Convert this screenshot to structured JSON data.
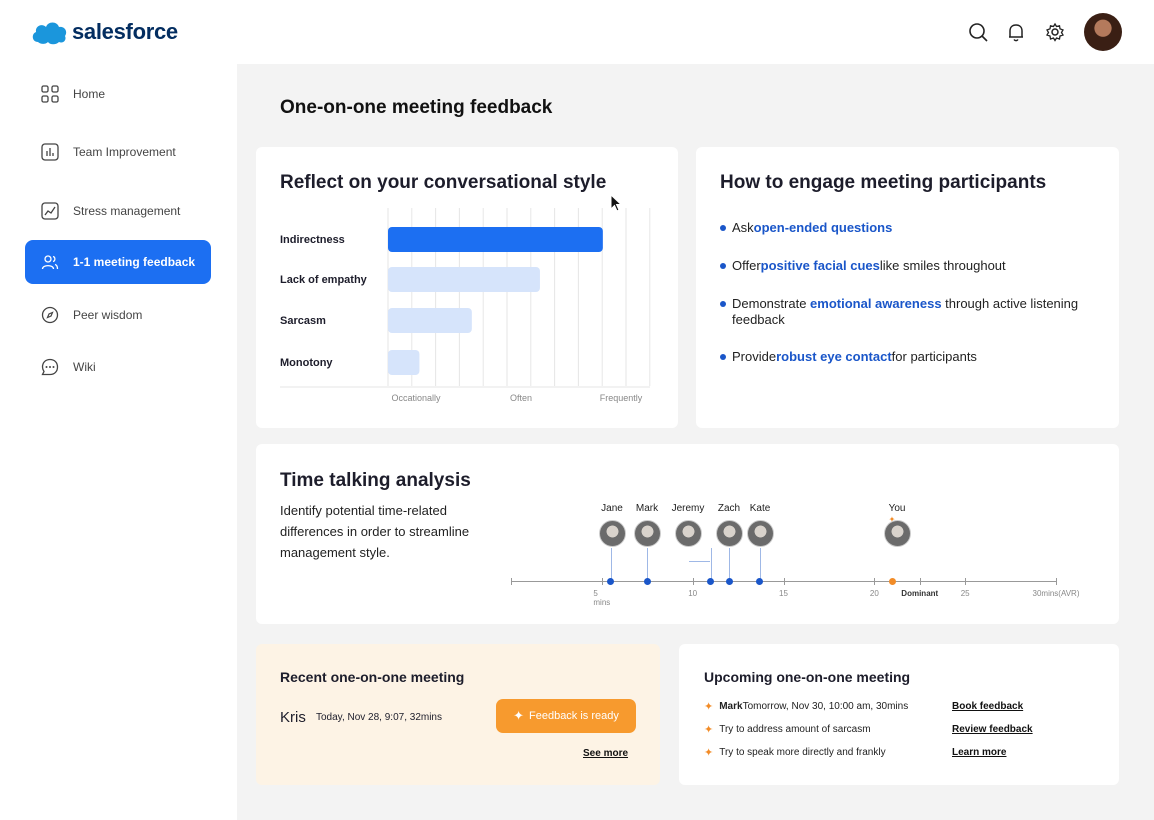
{
  "brand": {
    "name": "salesforce"
  },
  "header": {
    "icons": [
      "search-icon",
      "bell-icon",
      "gear-icon"
    ]
  },
  "sidebar": {
    "items": [
      {
        "label": "Home",
        "icon": "grid-icon"
      },
      {
        "label": "Team Improvement",
        "icon": "chart-icon"
      },
      {
        "label": "Stress management",
        "icon": "trend-icon"
      },
      {
        "label": "1-1 meeting feedback",
        "icon": "people-icon",
        "active": true
      },
      {
        "label": "Peer wisdom",
        "icon": "compass-icon"
      },
      {
        "label": "Wiki",
        "icon": "chat-icon"
      }
    ]
  },
  "page": {
    "title": "One-on-one meeting feedback"
  },
  "reflect": {
    "title": "Reflect on your conversational style",
    "chart_data": {
      "type": "bar",
      "orientation": "horizontal",
      "categories": [
        "Indirectness",
        "Lack of empathy",
        "Sarcasm",
        "Monotony"
      ],
      "values": [
        0.82,
        0.58,
        0.32,
        0.12
      ],
      "x_tick_labels": [
        "Occationally",
        "Often",
        "Frequently"
      ],
      "highlight_color": "#1c6ff2",
      "muted_color": "#d6e4fb",
      "grid": true
    }
  },
  "engage": {
    "title": "How to engage meeting participants",
    "items": [
      {
        "pre": "Ask ",
        "hl": "open-ended questions",
        "post": ""
      },
      {
        "pre": "Offer ",
        "hl": "positive facial cues",
        "post": " like smiles throughout"
      },
      {
        "pre": "Demonstrate ",
        "hl": "emotional awareness",
        "post": " through active listening feedback"
      },
      {
        "pre": "Provide ",
        "hl": "robust eye contact",
        "post": " for participants"
      }
    ]
  },
  "time": {
    "title": "Time talking analysis",
    "description": "Identify potential time-related differences in order to streamline management style.",
    "chart_data": {
      "type": "scatter",
      "axis_min": 0,
      "axis_max": 30,
      "ticks": [
        {
          "value": 5,
          "label": "5 mins"
        },
        {
          "value": 10,
          "label": "10"
        },
        {
          "value": 15,
          "label": "15"
        },
        {
          "value": 20,
          "label": "20"
        },
        {
          "value": 22.5,
          "label": "Dominant"
        },
        {
          "value": 25,
          "label": "25"
        },
        {
          "value": 30,
          "label": "30mins(AVR)"
        }
      ],
      "people": [
        {
          "name": "Jane",
          "value": 5.5
        },
        {
          "name": "Mark",
          "value": 7.5
        },
        {
          "name": "Jeremy",
          "value": 11
        },
        {
          "name": "Zach",
          "value": 12
        },
        {
          "name": "Kate",
          "value": 13.7
        },
        {
          "name": "You",
          "value": 21,
          "highlight": true
        }
      ],
      "point_color": "#1a56c9",
      "you_color": "#f28c28"
    }
  },
  "recent": {
    "title": "Recent one-on-one meeting",
    "person": "Kris",
    "when": "Today, Nov 28, 9:07, 32mins",
    "button": "Feedback is ready",
    "link": "See more"
  },
  "upcoming": {
    "title": "Upcoming one-on-one meeting",
    "rows": [
      {
        "bold": "Mark",
        "text": " Tomorrow, Nov 30, 10:00 am, 30mins",
        "link": "Book feedback"
      },
      {
        "bold": "",
        "text": "Try to address amount of sarcasm",
        "link": "Review feedback"
      },
      {
        "bold": "",
        "text": "Try to speak more directly and frankly",
        "link": "Learn more"
      }
    ]
  }
}
